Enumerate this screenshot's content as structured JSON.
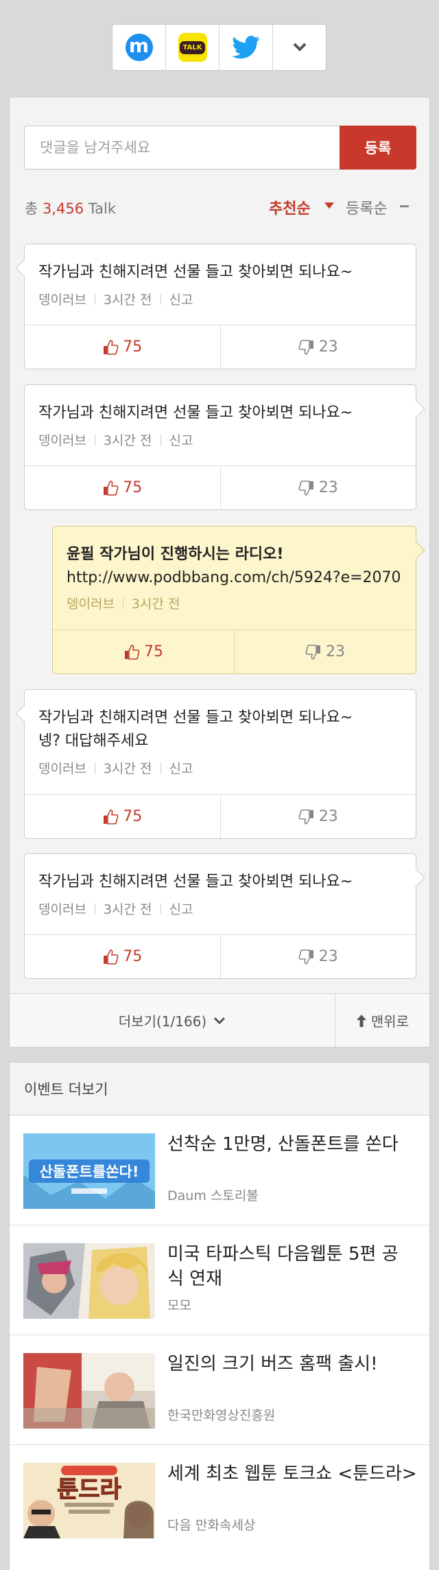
{
  "share": {
    "buttons": [
      {
        "name": "mypeople",
        "icon": "m-logo-icon"
      },
      {
        "name": "kakaotalk",
        "icon": "kakaotalk-icon",
        "label": "TALK"
      },
      {
        "name": "twitter",
        "icon": "twitter-bird-icon"
      },
      {
        "name": "more",
        "icon": "chevron-down-icon"
      }
    ]
  },
  "comments": {
    "input_placeholder": "댓글을 남겨주세요",
    "submit_label": "등록",
    "total_prefix": "총",
    "total_count": "3,456",
    "total_suffix": "Talk",
    "sort_recommend": "추천순",
    "sort_recent": "등록순",
    "items": [
      {
        "text": "작가님과 친해지려면 선물 들고 찾아뵈면 되나요~",
        "author": "뎅이러브",
        "time": "3시간 전",
        "report": "신고",
        "up": "75",
        "down": "23"
      },
      {
        "text": "작가님과 친해지려면 선물 들고 찾아뵈면 되나요~",
        "author": "뎅이러브",
        "time": "3시간 전",
        "report": "신고",
        "up": "75",
        "down": "23"
      },
      {
        "text_line1": "윤필 작가님이 진행하시는 라디오!",
        "text_line2": "http://www.podbbang.com/ch/5924?e=2070",
        "author": "뎅이러브",
        "time": "3시간 전",
        "up": "75",
        "down": "23"
      },
      {
        "text_line1": "작가님과 친해지려면 선물 들고 찾아뵈면 되나요~",
        "text_line2": "넹? 대답해주세요",
        "author": "뎅이러브",
        "time": "3시간 전",
        "report": "신고",
        "up": "75",
        "down": "23"
      },
      {
        "text": "작가님과 친해지려면 선물 들고 찾아뵈면 되나요~",
        "author": "뎅이러브",
        "time": "3시간 전",
        "report": "신고",
        "up": "75",
        "down": "23"
      }
    ],
    "more_label": "더보기(1/166)",
    "top_label": "맨위로"
  },
  "events": {
    "heading": "이벤트 더보기",
    "items": [
      {
        "title": "선착순 1만명, 산돌폰트를 쏜다",
        "source": "Daum 스토리볼",
        "thumb_text": "산돌폰트를쏜다!"
      },
      {
        "title_line1": "미국 타파스틱 다음웹툰 5편 공",
        "title_line2": "식 연재",
        "source": "모모"
      },
      {
        "title": "일진의 크기 버즈 홈팩 출시!",
        "source": "한국만화영상진흥원"
      },
      {
        "title": "세계 최초 웹툰 토크쇼 <툰드라>",
        "source": "다음 만화속세상",
        "thumb_text": "툰드라"
      }
    ]
  }
}
